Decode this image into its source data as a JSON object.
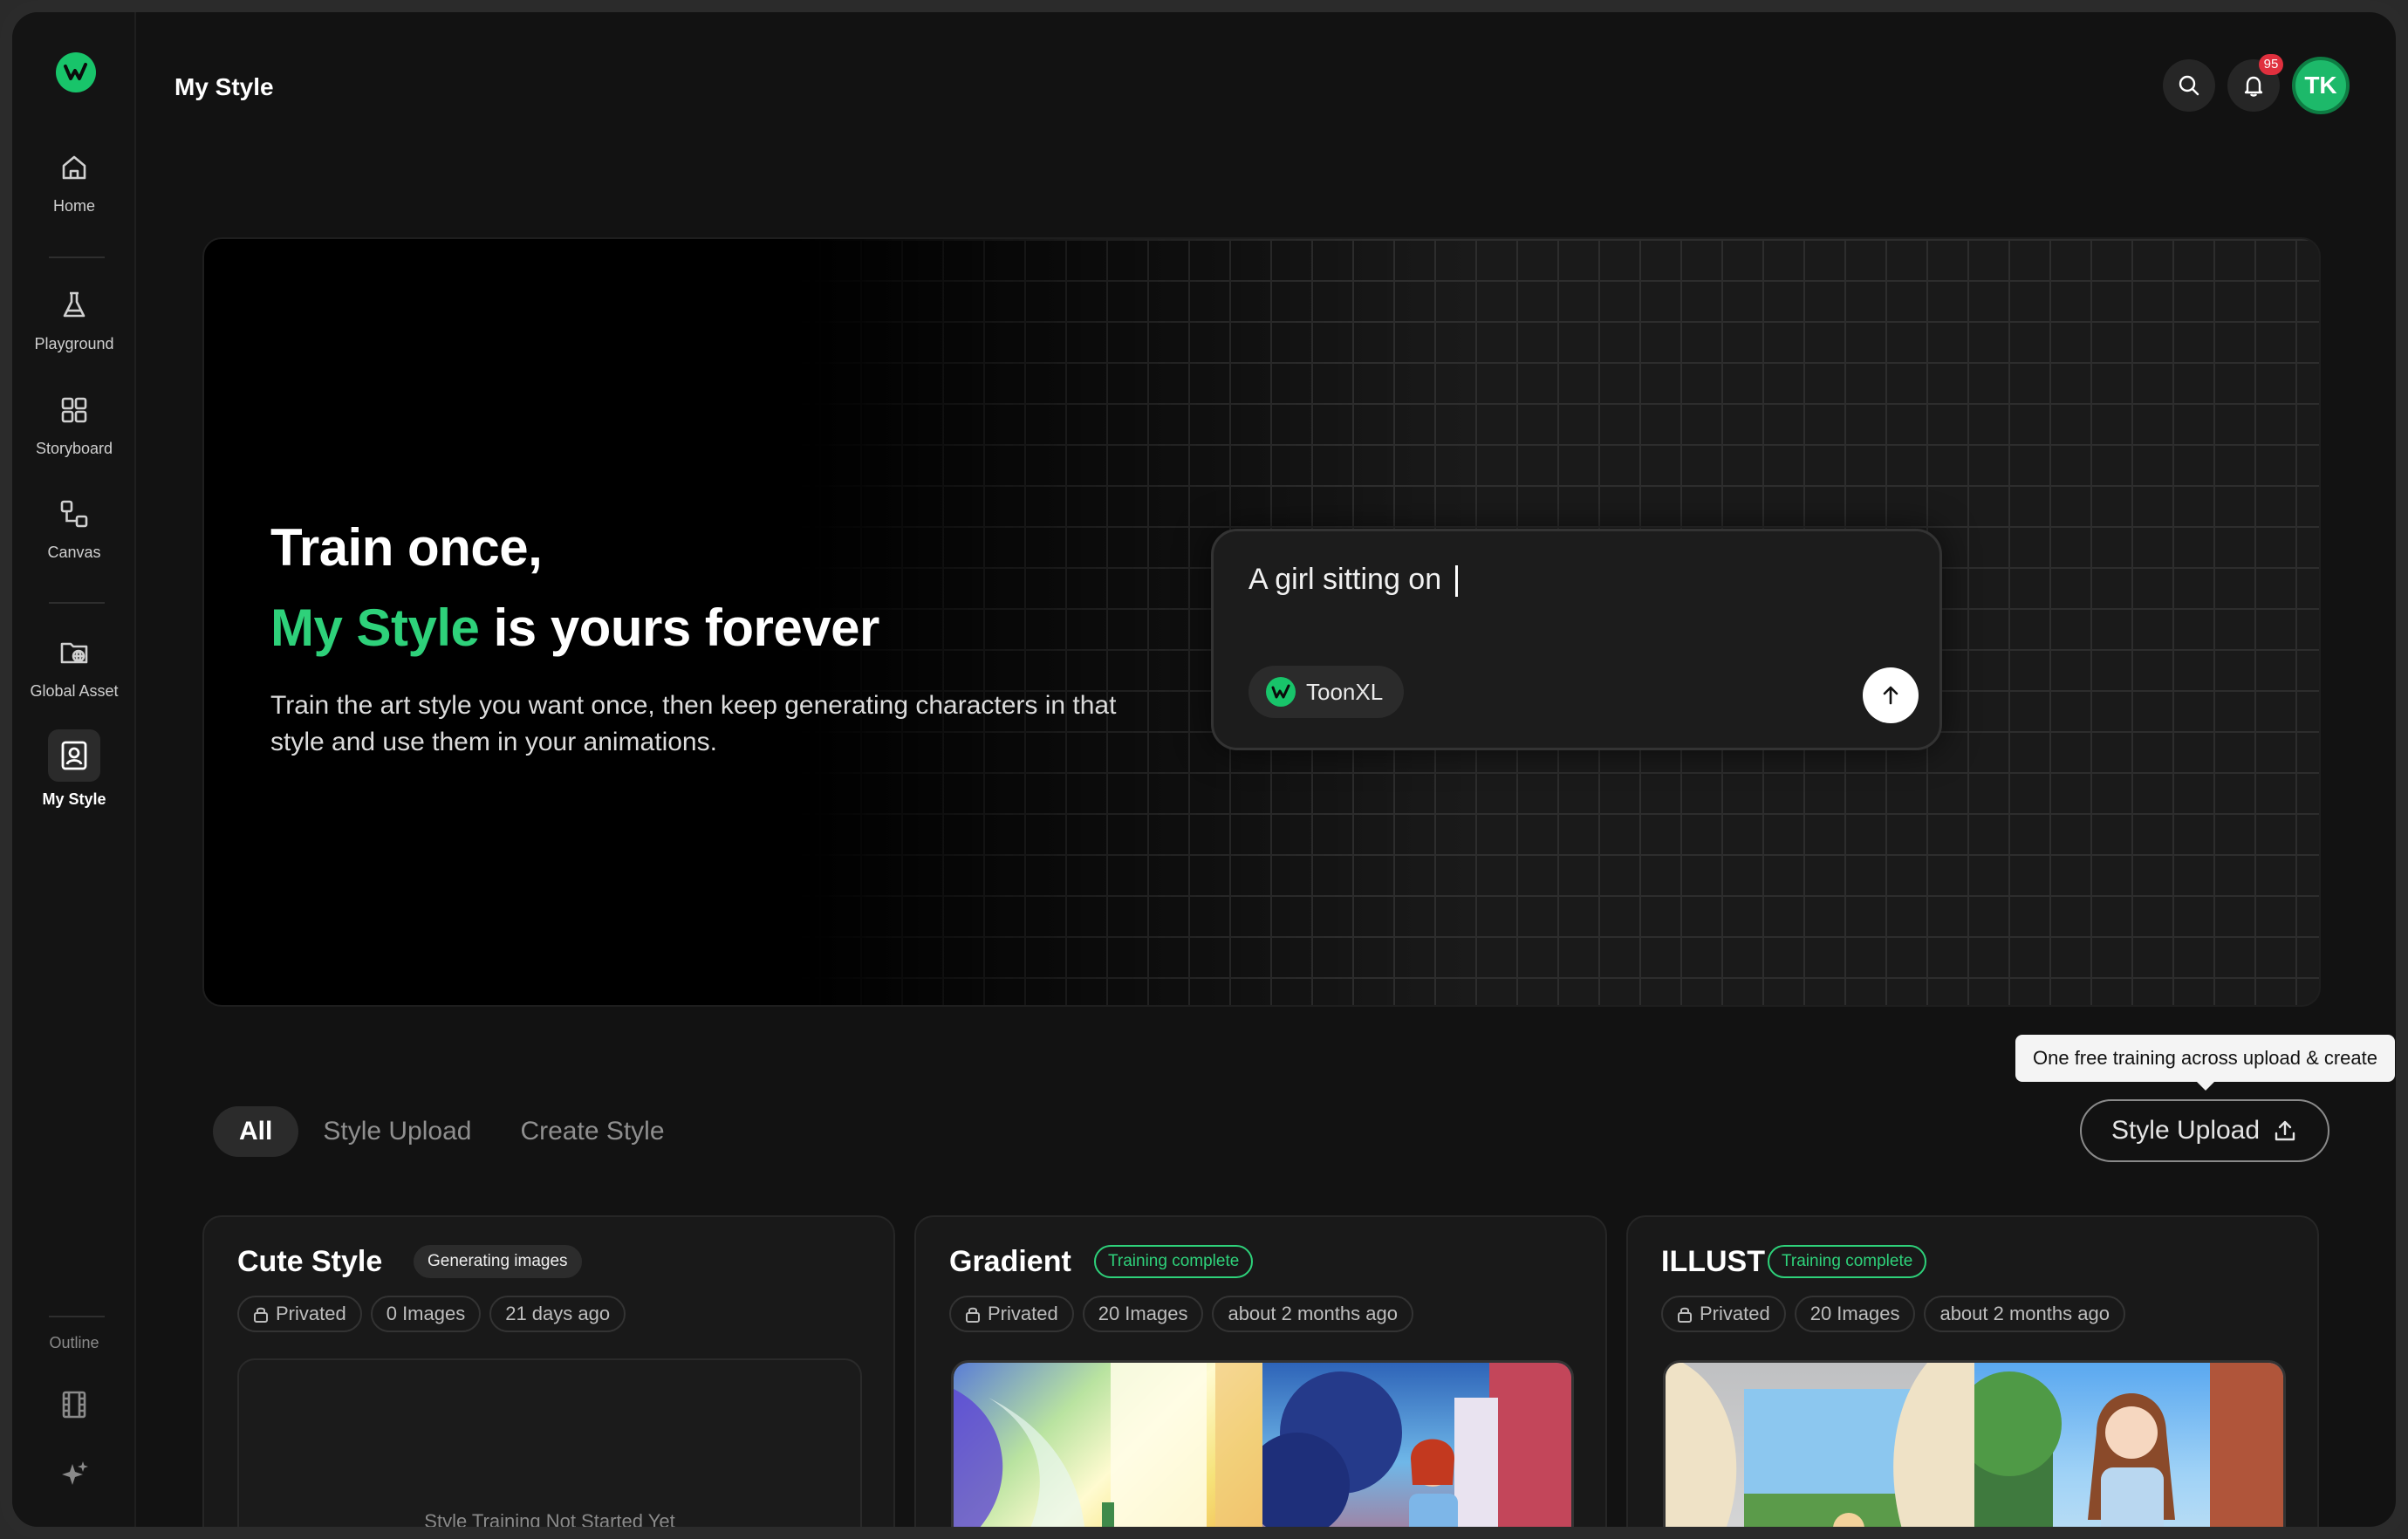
{
  "app": {
    "page_title": "My Style"
  },
  "sidebar": {
    "items": [
      {
        "label": "Home",
        "icon": "home-icon"
      },
      {
        "label": "Playground",
        "icon": "flask-icon"
      },
      {
        "label": "Storyboard",
        "icon": "grid-icon"
      },
      {
        "label": "Canvas",
        "icon": "nodes-icon"
      },
      {
        "label": "Global Asset",
        "icon": "globe-folder-icon"
      },
      {
        "label": "My Style",
        "icon": "portrait-icon",
        "active": true
      }
    ],
    "outline_label": "Outline",
    "bottom_icons": [
      "film-icon",
      "sparkles-icon"
    ]
  },
  "header": {
    "notification_count": "95",
    "avatar_initials": "TK"
  },
  "hero": {
    "line1": "Train once,",
    "line2_accent": "My Style",
    "line2_rest": " is yours forever",
    "description": "Train the art style you want once, then keep generating characters in that style and use them in your animations.",
    "prompt_text": "A girl sitting on ",
    "model": "ToonXL"
  },
  "tabs": [
    "All",
    "Style Upload",
    "Create Style"
  ],
  "active_tab": "All",
  "tooltip": "One free training across upload & create",
  "upload_button": "Style Upload",
  "cards": [
    {
      "title": "Cute Style",
      "status": "Generating images",
      "privacy": "Privated",
      "images": "0 Images",
      "date": "21 days ago",
      "empty_text": "Style Training Not Started Yet"
    },
    {
      "title": "Gradient",
      "status": "Training complete",
      "privacy": "Privated",
      "images": "20 Images",
      "date": "about 2 months ago"
    },
    {
      "title": "ILLUST",
      "status": "Training complete",
      "privacy": "Privated",
      "images": "20 Images",
      "date": "about 2 months ago"
    }
  ],
  "colors": {
    "accent": "#2ed17a",
    "badge": "#e0303e",
    "background": "#121212"
  }
}
